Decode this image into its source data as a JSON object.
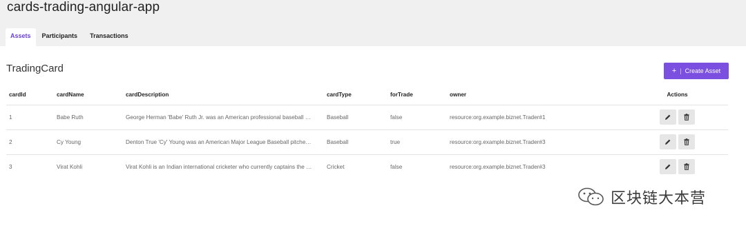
{
  "app": {
    "title": "cards-trading-angular-app"
  },
  "tabs": [
    {
      "label": "Assets",
      "active": true
    },
    {
      "label": "Participants",
      "active": false
    },
    {
      "label": "Transactions",
      "active": false
    }
  ],
  "section": {
    "title": "TradingCard"
  },
  "create_button": {
    "icon": "plus",
    "label": "Create Asset"
  },
  "table": {
    "headers": [
      "cardId",
      "cardName",
      "cardDescription",
      "cardType",
      "forTrade",
      "owner",
      "Actions"
    ],
    "rows": [
      {
        "cardId": "1",
        "cardName": "Babe Ruth",
        "cardDescription": "George Herman 'Babe' Ruth Jr. was an American professional baseball …",
        "cardType": "Baseball",
        "forTrade": "false",
        "owner": "resource:org.example.biznet.Trader#1"
      },
      {
        "cardId": "2",
        "cardName": "Cy Young",
        "cardDescription": "Denton True 'Cy' Young was an American Major League Baseball pitche…",
        "cardType": "Baseball",
        "forTrade": "true",
        "owner": "resource:org.example.biznet.Trader#3"
      },
      {
        "cardId": "3",
        "cardName": "Virat Kohli",
        "cardDescription": "Virat Kohli is an Indian international cricketer who currently captains the …",
        "cardType": "Cricket",
        "forTrade": "false",
        "owner": "resource:org.example.biznet.Trader#3"
      }
    ]
  },
  "watermark": {
    "text": "区块链大本营"
  },
  "colors": {
    "accent": "#7b4fe0",
    "header_bg": "#f0f0f0",
    "action_bg": "#e6e6e6"
  }
}
